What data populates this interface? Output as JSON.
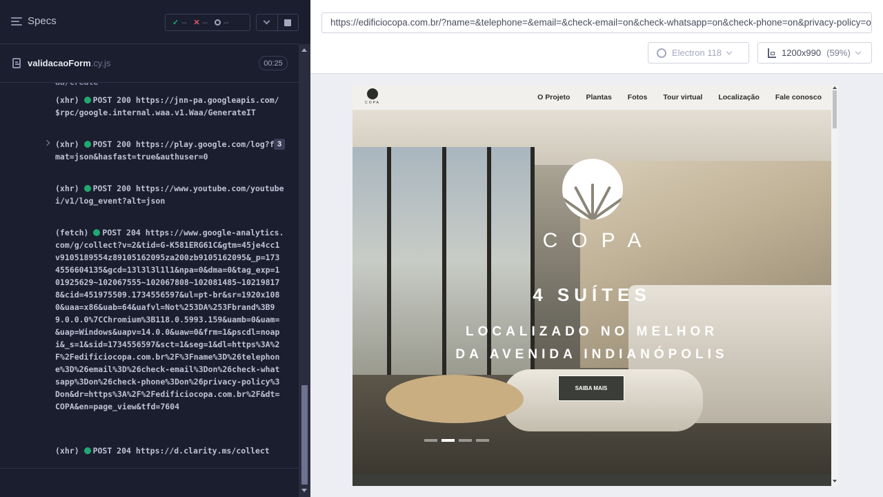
{
  "reporter": {
    "specs_label": "Specs",
    "stats": {
      "passed": "--",
      "failed": "--",
      "pending": "--"
    },
    "spec_file": {
      "name": "validacaoForm",
      "ext": ".cy.js",
      "duration": "00:25"
    },
    "log_cut_text": "aa/Create",
    "log": [
      {
        "kind": "(xhr)",
        "text": "POST 200 https://jnn-pa.googleapis.com/$rpc/google.internal.waa.v1.Waa/GenerateIT"
      },
      {
        "kind": "(xhr)",
        "text": "POST 200 https://play.google.com/log?format=json&hasfast=true&authuser=0",
        "count": "3"
      },
      {
        "kind": "(xhr)",
        "text": "POST 200 https://www.youtube.com/youtubei/v1/log_event?alt=json"
      },
      {
        "kind": "(fetch)",
        "text": "POST 204 https://www.google-analytics.com/g/collect?v=2&tid=G-K581ERG61C&gtm=45je4cc1v9105189554z89105162095za200zb9105162095&_p=1734556604135&gcd=13l3l3l1l1&npa=0&dma=0&tag_exp=101925629~102067555~102067808~102081485~102198178&cid=451975509.1734556597&ul=pt-br&sr=1920x1080&uaa=x86&uab=64&uafvl=Not%253DA%253Fbrand%3B99.0.0.0%7CChromium%3B118.0.5993.159&uamb=0&uam=&uap=Windows&uapv=14.0.0&uaw=0&frm=1&pscdl=noapi&_s=1&sid=1734556597&sct=1&seg=1&dl=https%3A%2F%2Fedificiocopa.com.br%2F%3Fname%3D%26telephone%3D%26email%3D%26check-email%3Don%26check-whatsapp%3Don%26check-phone%3Don%26privacy-policy%3Don&dr=https%3A%2F%2Fedificiocopa.com.br%2F&dt=COPA&en=page_view&tfd=7604"
      },
      {
        "kind": "(xhr)",
        "text": "POST 204 https://d.clarity.ms/collect"
      }
    ]
  },
  "runner": {
    "url": "https://edificiocopa.com.br/?name=&telephone=&email=&check-email=on&check-whatsapp=on&check-phone=on&privacy-policy=on",
    "browser": "Electron 118",
    "viewport": "1200x990",
    "scale": "(59%)"
  },
  "site": {
    "logo_text": "COPA",
    "nav": [
      "O Projeto",
      "Plantas",
      "Fotos",
      "Tour virtual",
      "Localização",
      "Fale conosco"
    ],
    "hero_word": "COPA",
    "headline": "4 SUÍTES",
    "tagline_1": "LOCALIZADO NO MELHOR",
    "tagline_2": "DA AVENIDA INDIANÓPOLIS",
    "cta": "SAIBA MAIS",
    "slides": 4,
    "active_slide": 2
  }
}
